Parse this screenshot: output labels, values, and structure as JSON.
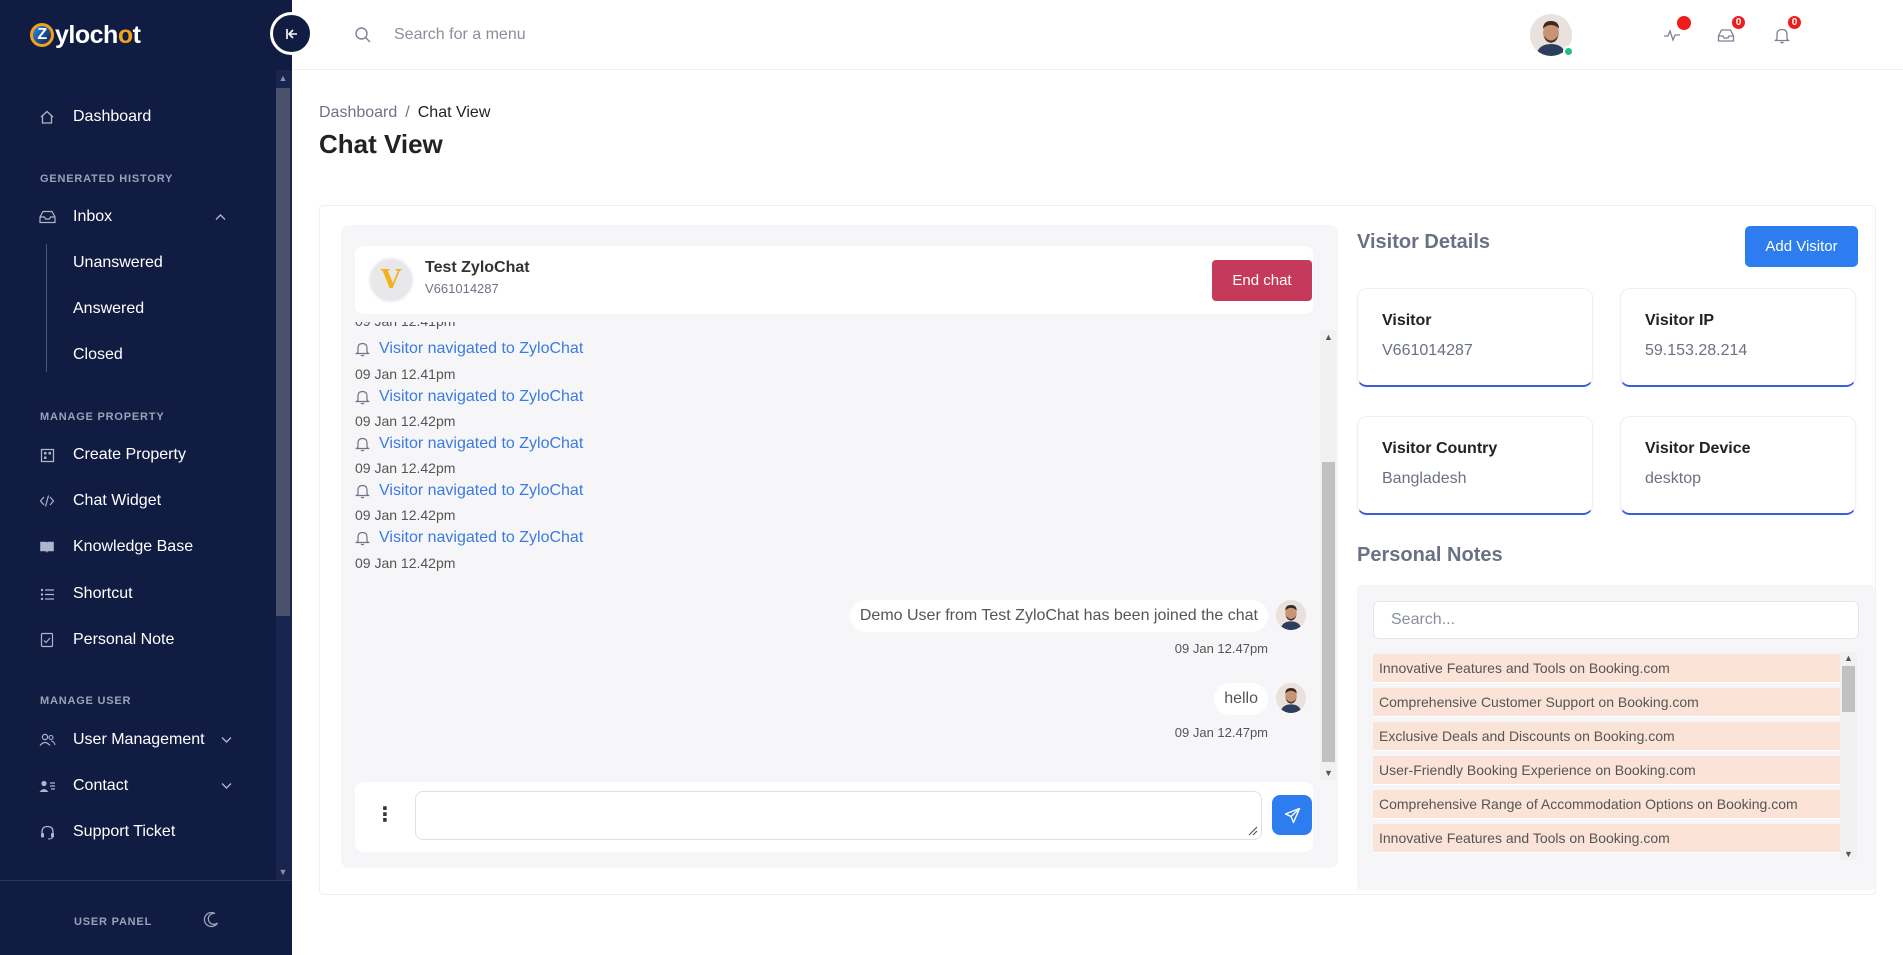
{
  "app": {
    "logo_text_pre": "ylo",
    "logo_text_mid": "ch",
    "logo_text_o": "o",
    "logo_text_post": "t",
    "logo_z": "Z"
  },
  "sidebar": {
    "dashboard": "Dashboard",
    "section_history": "GENERATED HISTORY",
    "inbox": "Inbox",
    "inbox_sub": [
      "Unanswered",
      "Answered",
      "Closed"
    ],
    "section_property": "MANAGE PROPERTY",
    "property_items": [
      "Create Property",
      "Chat Widget",
      "Knowledge Base",
      "Shortcut",
      "Personal Note"
    ],
    "section_user": "MANAGE USER",
    "user_items": [
      "User Management",
      "Contact",
      "Support Ticket"
    ],
    "footer_label": "USER PANEL"
  },
  "header": {
    "search_placeholder": "Search for a menu",
    "notif_counts": [
      "0",
      "0"
    ]
  },
  "page": {
    "breadcrumb_root": "Dashboard",
    "breadcrumb_sep": "/",
    "breadcrumb_current": "Chat View",
    "title": "Chat View"
  },
  "chat": {
    "avatar_letter": "V",
    "name": "Test ZyloChat",
    "visitor_id": "V661014287",
    "end_chat_label": "End chat",
    "events": [
      {
        "text": "Visitor navigated to ZyloChat",
        "time": "09 Jan 12.41pm"
      },
      {
        "text": "Visitor navigated to ZyloChat",
        "time": "09 Jan 12.42pm"
      },
      {
        "text": "Visitor navigated to ZyloChat",
        "time": "09 Jan 12.42pm"
      },
      {
        "text": "Visitor navigated to ZyloChat",
        "time": "09 Jan 12.42pm"
      },
      {
        "text": "Visitor navigated to ZyloChat",
        "time": "09 Jan 12.42pm"
      }
    ],
    "messages": [
      {
        "text": "Demo User from Test ZyloChat has been joined the chat",
        "time": "09 Jan 12.47pm"
      },
      {
        "text": "hello",
        "time": "09 Jan 12.47pm"
      }
    ],
    "compose_value": ""
  },
  "visitor": {
    "title": "Visitor Details",
    "add_label": "Add Visitor",
    "fields": [
      {
        "label": "Visitor",
        "value": "V661014287"
      },
      {
        "label": "Visitor IP",
        "value": "59.153.28.214"
      },
      {
        "label": "Visitor Country",
        "value": "Bangladesh"
      },
      {
        "label": "Visitor Device",
        "value": "desktop"
      }
    ]
  },
  "notes": {
    "title": "Personal Notes",
    "search_placeholder": "Search...",
    "items": [
      "Innovative Features and Tools on Booking.com",
      "Comprehensive Customer Support on Booking.com",
      "Exclusive Deals and Discounts on Booking.com",
      "User-Friendly Booking Experience on Booking.com",
      "Comprehensive Range of Accommodation Options on Booking.com",
      "Innovative Features and Tools on Booking.com"
    ]
  },
  "colors": {
    "sidebar_bg": "#111c43",
    "accent_blue": "#2d7df0",
    "end_chat": "#c53a5a",
    "note_bg": "#fbe4d7",
    "event_link": "#3a7be0"
  }
}
